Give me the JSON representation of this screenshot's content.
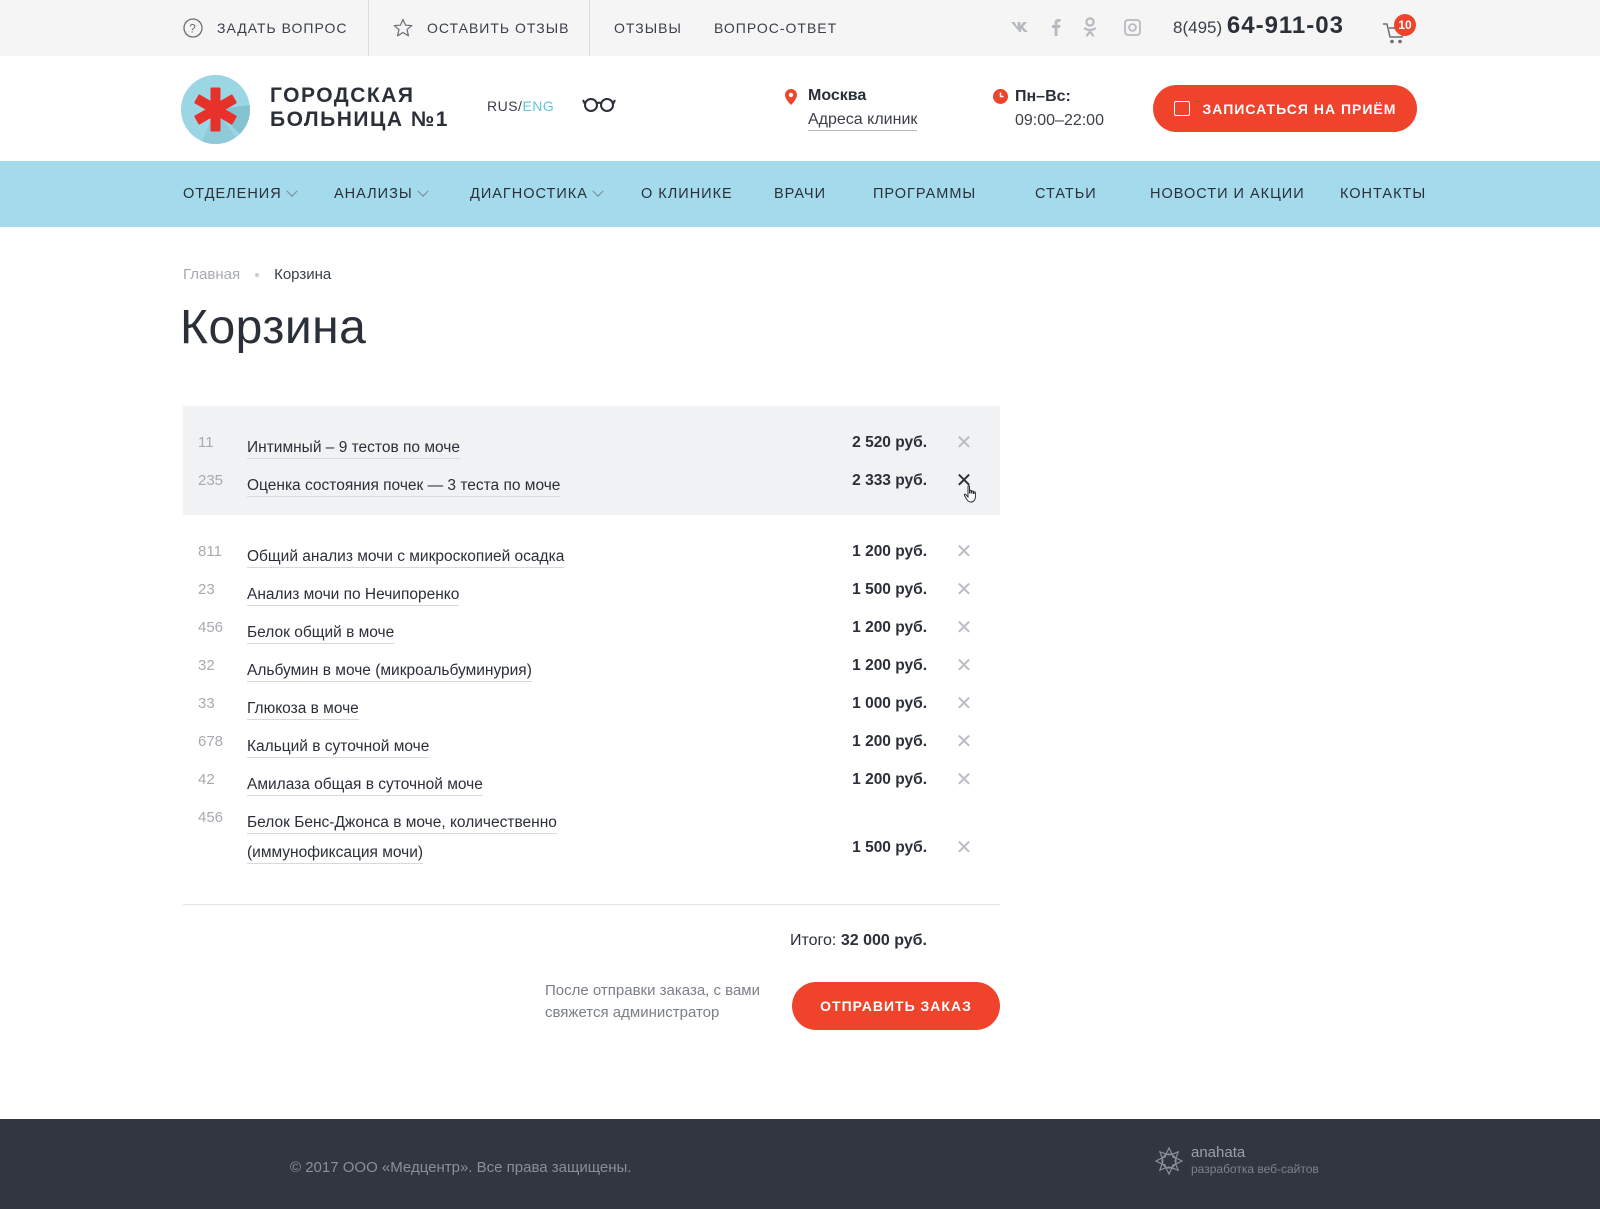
{
  "topbar": {
    "ask_question": "Задать вопрос",
    "leave_review": "Оставить отзыв",
    "reviews": "Отзывы",
    "faq": "Вопрос-ответ",
    "social": [
      "vk",
      "f",
      "ok",
      "instagram"
    ],
    "phone_prefix": "8(495)",
    "phone_number": "64-911-03",
    "cart_count": "10"
  },
  "header": {
    "logo_line1": "ГОРОДСКАЯ",
    "logo_line2": "БОЛЬНИЦА №1",
    "lang_rus": "RUS/",
    "lang_eng": "ENG",
    "city": "Москва",
    "addresses_link": "Адреса клиник",
    "hours_label": "Пн–Вс:",
    "hours": "09:00–22:00",
    "appoint_button": "Записаться на приём"
  },
  "nav": [
    {
      "label": "Отделения",
      "dropdown": true
    },
    {
      "label": "Анализы",
      "dropdown": true
    },
    {
      "label": "Диагностика",
      "dropdown": true
    },
    {
      "label": "О клинике",
      "dropdown": false
    },
    {
      "label": "Врачи",
      "dropdown": false
    },
    {
      "label": "Программы",
      "dropdown": false
    },
    {
      "label": "Статьи",
      "dropdown": false
    },
    {
      "label": "Новости и акции",
      "dropdown": false
    },
    {
      "label": "Контакты",
      "dropdown": false
    }
  ],
  "breadcrumb": {
    "home": "Главная",
    "current": "Корзина"
  },
  "page_title": "Корзина",
  "cart_items": [
    {
      "num": "11",
      "name": "Интимный – 9 тестов по моче",
      "price": "2 520 руб."
    },
    {
      "num": "235",
      "name": "Оценка состояния почек — 3 теста по моче",
      "price": "2 333 руб."
    },
    {
      "num": "811",
      "name": "Общий анализ мочи с микроскопией осадка",
      "price": "1 200 руб."
    },
    {
      "num": "23",
      "name": "Анализ мочи по Нечипоренко",
      "price": "1 500 руб."
    },
    {
      "num": "456",
      "name": "Белок общий в моче",
      "price": "1 200 руб."
    },
    {
      "num": "32",
      "name": "Альбумин в моче (микроальбуминурия)",
      "price": "1 200 руб."
    },
    {
      "num": "33",
      "name": "Глюкоза в моче",
      "price": "1 000 руб."
    },
    {
      "num": "678",
      "name": "Кальций в суточной моче",
      "price": "1 200 руб."
    },
    {
      "num": "42",
      "name": "Амилаза общая в суточной моче",
      "price": "1 200 руб."
    },
    {
      "num": "456",
      "name_line1": "Белок Бенс-Джонса в моче, количественно",
      "name_line2": "(иммунофиксация мочи)",
      "price": "1 500 руб."
    }
  ],
  "total_label": "Итого:",
  "total_value": "32 000 руб.",
  "order_note": "После отправки заказа, с вами свяжется администратор",
  "send_button": "Отправить заказ",
  "footer": {
    "copyright": "© 2017 ООО «Медцентр». Все права защищены.",
    "dev_name": "anahata",
    "dev_tagline": "разработка веб-сайтов"
  },
  "colors": {
    "accent": "#f0432c",
    "nav_bg": "#a3dbec",
    "footer_bg": "#323641",
    "lang_active": "#5ec6d9"
  }
}
